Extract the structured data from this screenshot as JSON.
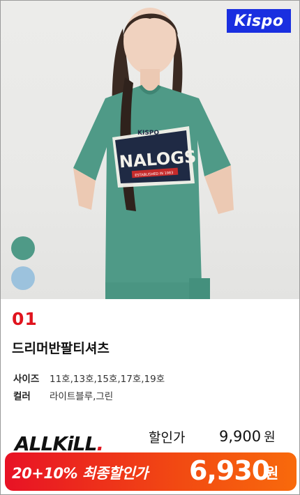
{
  "brand": {
    "logo_text": "Kispo"
  },
  "product": {
    "number": "01",
    "title": "드리머반팔티셔츠",
    "specs": {
      "size_label": "사이즈",
      "size_value": "11호,13호,15호,17호,19호",
      "color_label": "컬러",
      "color_value": "라이트블루,그린"
    },
    "swatches": [
      {
        "name": "그린",
        "hex": "#4f9a87"
      },
      {
        "name": "라이트블루",
        "hex": "#9cc2dd"
      }
    ],
    "shirt_print": {
      "brand": "KISPO",
      "word": "NALOGS",
      "ribbon": "ESTABLISHED IN 1983"
    }
  },
  "promo": {
    "badge_main": "ALLKiLL",
    "badge_dot": "."
  },
  "pricing": {
    "sale_label": "할인가",
    "sale_price": "9,900",
    "sale_unit": "원",
    "final_label": "20+10% 최종할인가",
    "final_price": "6,930",
    "final_unit": "원"
  },
  "colors": {
    "accent_red": "#e0141e",
    "logo_blue": "#1a2fe0",
    "shirt_green": "#4f9a87"
  }
}
